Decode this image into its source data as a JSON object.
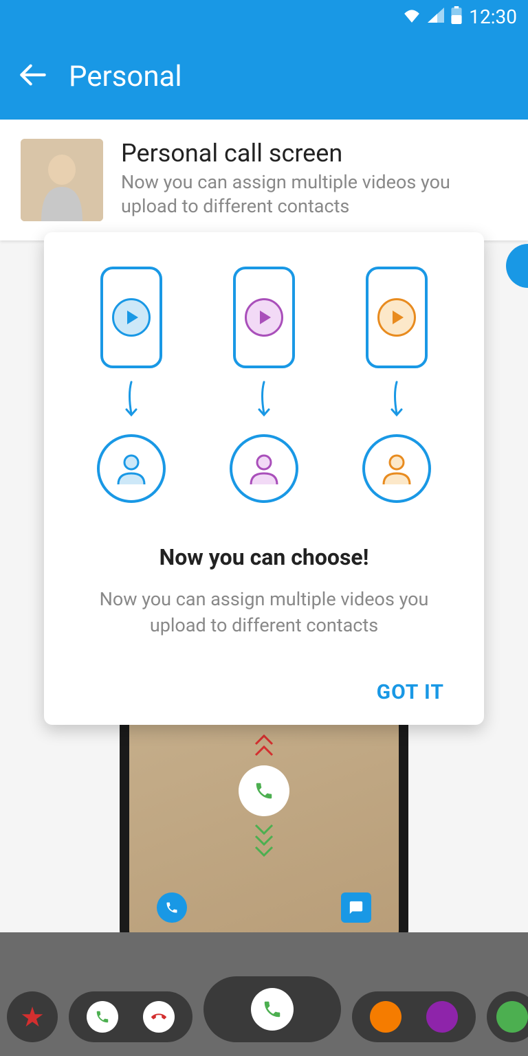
{
  "status": {
    "time": "12:30"
  },
  "appbar": {
    "title": "Personal"
  },
  "header": {
    "title": "Personal call screen",
    "subtitle": "Now you can assign multiple videos you upload  to different contacts"
  },
  "dialog": {
    "title": "Now you can choose!",
    "body": "Now you can assign multiple videos you upload to different contacts",
    "action": "GOT IT"
  },
  "colors": {
    "primary": "#1998e5",
    "purple": "#a94fba",
    "orange": "#e88b1f"
  }
}
